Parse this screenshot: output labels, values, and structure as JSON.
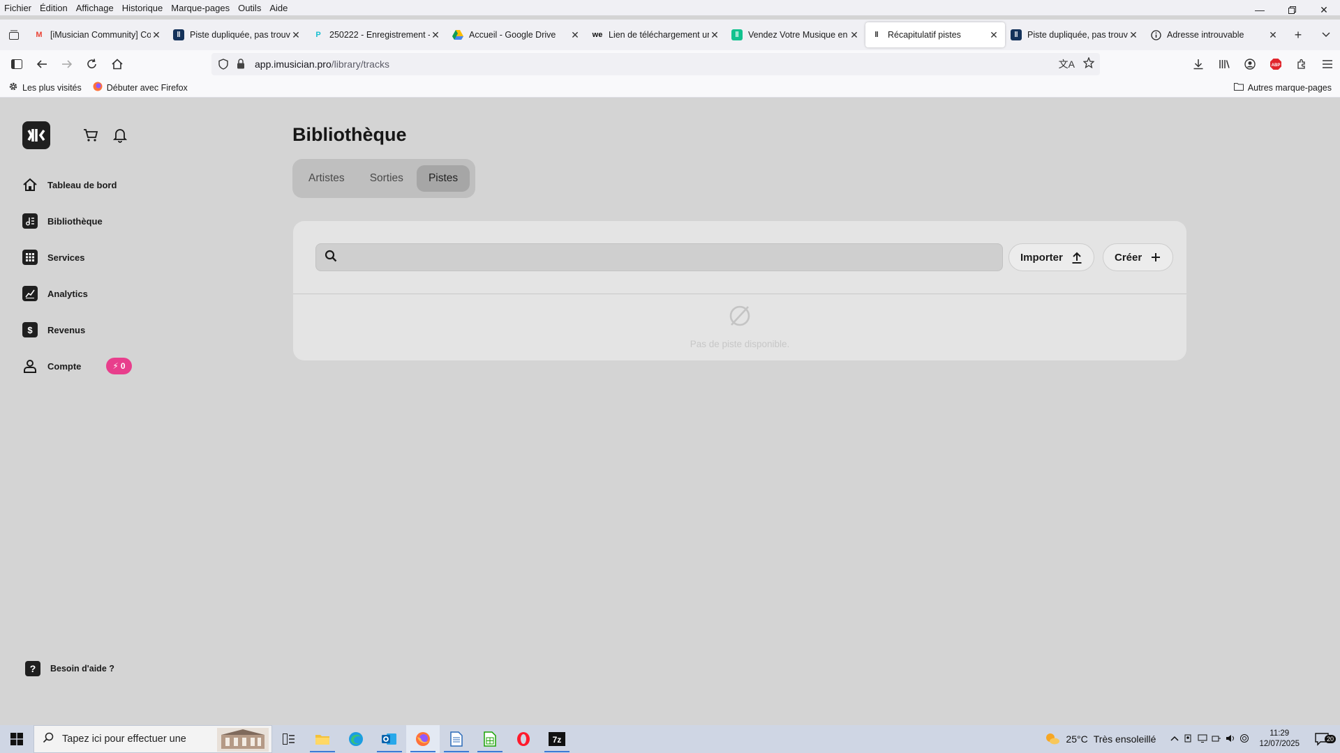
{
  "menubar": {
    "items": [
      "Fichier",
      "Édition",
      "Affichage",
      "Historique",
      "Marque-pages",
      "Outils",
      "Aide"
    ]
  },
  "tabs": [
    {
      "title": "[iMusician Community] Co",
      "favicon": "gmail-icon"
    },
    {
      "title": "Piste dupliquée, pas trouvé",
      "favicon": "imusician-icon"
    },
    {
      "title": "250222 - Enregistrement -",
      "favicon": "pcloud-icon"
    },
    {
      "title": "Accueil - Google Drive",
      "favicon": "google-drive-icon"
    },
    {
      "title": "Lien de téléchargement un",
      "favicon": "wetransfer-icon"
    },
    {
      "title": "Vendez Votre Musique en L",
      "favicon": "imusician-green-icon"
    },
    {
      "title": "Récapitulatif pistes",
      "favicon": "imusician-icon",
      "active": true
    },
    {
      "title": "Piste dupliquée, pas trouvé",
      "favicon": "imusician-icon"
    },
    {
      "title": "Adresse introuvable",
      "favicon": "info-icon"
    }
  ],
  "url": {
    "host": "app.imusician.pro",
    "path": "/library/tracks"
  },
  "bookmarks": {
    "most_visited": "Les plus visités",
    "getting_started": "Débuter avec Firefox",
    "other": "Autres marque-pages"
  },
  "sidebar": {
    "items": [
      {
        "label": "Tableau de bord",
        "icon": "home-icon"
      },
      {
        "label": "Bibliothèque",
        "icon": "library-icon"
      },
      {
        "label": "Services",
        "icon": "grid-icon"
      },
      {
        "label": "Analytics",
        "icon": "chart-icon"
      },
      {
        "label": "Revenus",
        "icon": "revenue-icon"
      },
      {
        "label": "Compte",
        "icon": "user-icon"
      }
    ],
    "account_badge": "0",
    "help": "Besoin d'aide ?"
  },
  "page": {
    "title": "Bibliothèque",
    "tabs": [
      "Artistes",
      "Sorties",
      "Pistes"
    ],
    "active_tab": "Pistes",
    "search_placeholder": "",
    "import_label": "Importer",
    "create_label": "Créer",
    "empty_text": "Pas de piste disponible."
  },
  "taskbar": {
    "search_placeholder": "Tapez ici pour effectuer une",
    "weather_temp": "25°C",
    "weather_text": "Très ensoleillé",
    "time": "11:29",
    "date": "12/07/2025",
    "notifications": "20"
  },
  "colors": {
    "badge": "#e83e8c",
    "app_bg": "#d4d4d4",
    "card_bg": "#e4e4e4"
  }
}
